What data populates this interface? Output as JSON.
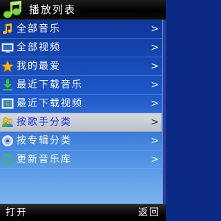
{
  "title": "播放列表",
  "icons": {
    "app": "music-notes-icon"
  },
  "menu": {
    "items": [
      {
        "label": "全部音乐",
        "icon": "music-note-icon"
      },
      {
        "label": "全部视频",
        "icon": "video-screen-icon"
      },
      {
        "label": "我的最爱",
        "icon": "star-icon"
      },
      {
        "label": "最近下载音乐",
        "icon": "download-music-icon"
      },
      {
        "label": "最近下载视频",
        "icon": "download-video-icon"
      },
      {
        "label": "按歌手分类",
        "icon": "artist-icon"
      },
      {
        "label": "按专辑分类",
        "icon": "album-disc-icon"
      },
      {
        "label": "更新音乐库",
        "icon": "refresh-icon"
      }
    ],
    "selected_index": 5,
    "chevron": ">"
  },
  "softkeys": {
    "left": "打开",
    "right": "返回"
  },
  "colors": {
    "selected_text": "#1a2fd6",
    "selected_bg": "#c8ccd4"
  }
}
